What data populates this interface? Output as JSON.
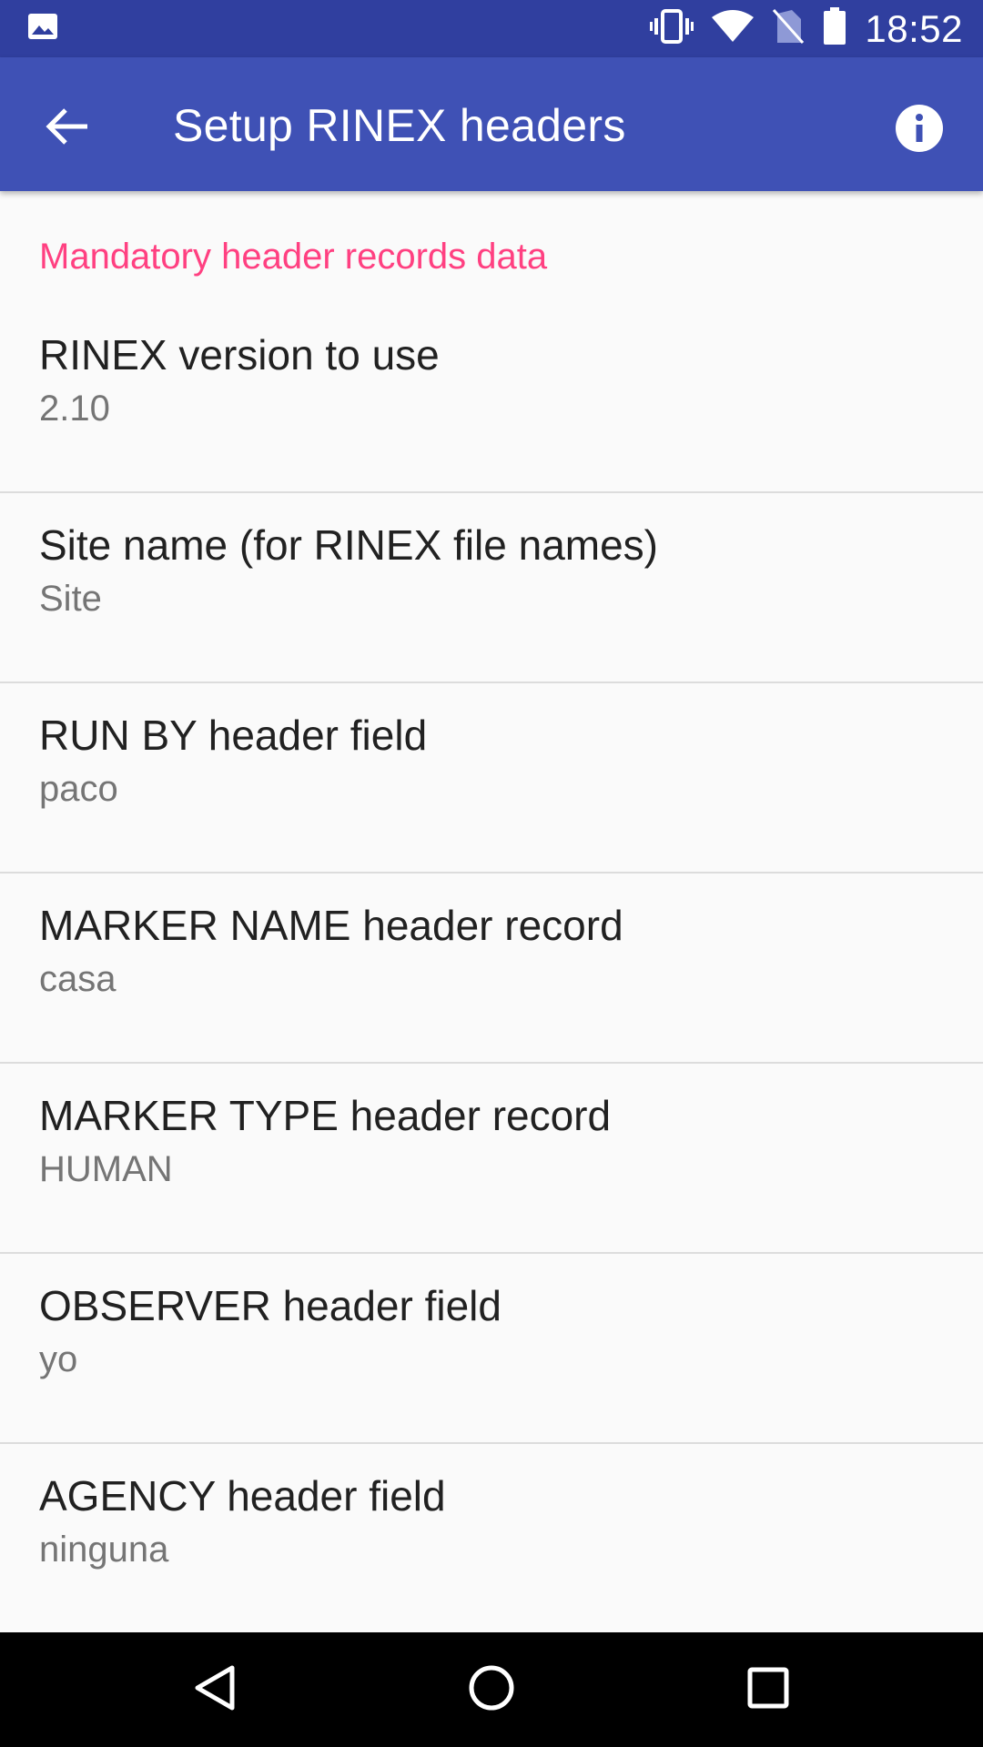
{
  "status_bar": {
    "time": "18:52",
    "icons": [
      "image-notification-icon",
      "vibrate-icon",
      "wifi-icon",
      "no-sim-icon",
      "battery-icon"
    ]
  },
  "app_bar": {
    "title": "Setup RINEX headers",
    "back_icon": "arrow-back-icon",
    "info_icon": "info-icon",
    "color": "#3f51b5"
  },
  "preferences": {
    "category": "Mandatory header records data",
    "accent_color": "#ff4081",
    "items": [
      {
        "title": "RINEX version to use",
        "summary": "2.10"
      },
      {
        "title": "Site name (for RINEX file names)",
        "summary": "Site"
      },
      {
        "title": "RUN BY header field",
        "summary": "paco"
      },
      {
        "title": "MARKER NAME header record",
        "summary": "casa"
      },
      {
        "title": "MARKER TYPE header record",
        "summary": "HUMAN"
      },
      {
        "title": "OBSERVER header field",
        "summary": "yo"
      },
      {
        "title": "AGENCY header field",
        "summary": "ninguna"
      }
    ]
  },
  "nav_bar": {
    "buttons": [
      "back-triangle-icon",
      "home-circle-icon",
      "recents-square-icon"
    ]
  }
}
